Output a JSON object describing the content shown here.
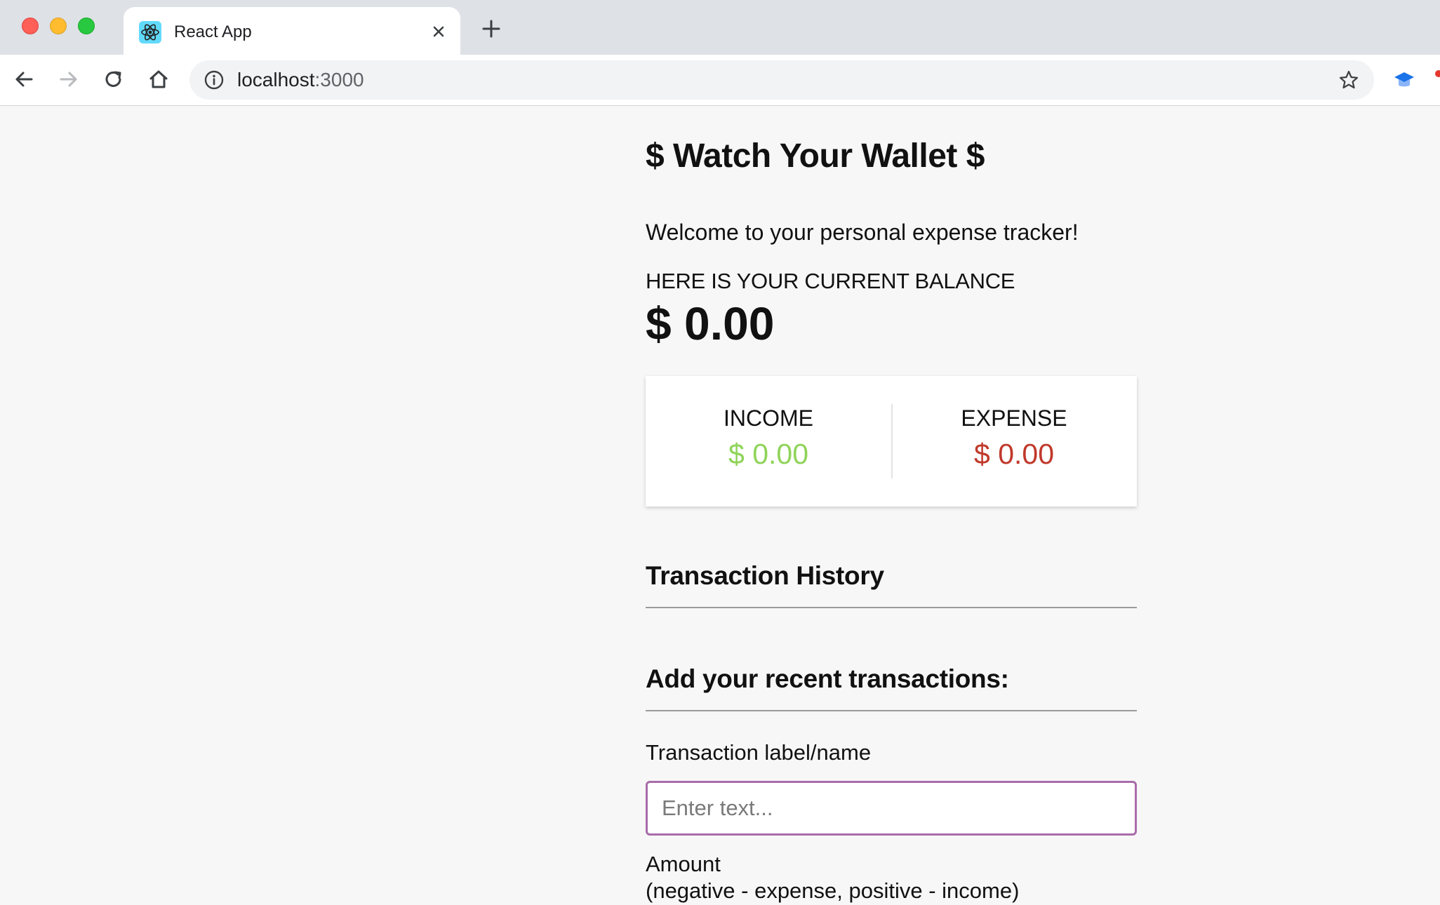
{
  "browser": {
    "tab_title": "React App",
    "url_host": "localhost",
    "url_port": ":3000"
  },
  "app": {
    "title": "$ Watch Your Wallet $",
    "welcome": "Welcome to your personal expense tracker!",
    "balance_label": "HERE IS YOUR CURRENT BALANCE",
    "balance_value": "$ 0.00",
    "income": {
      "label": "INCOME",
      "value": "$ 0.00",
      "color": "#8fd45a"
    },
    "expense": {
      "label": "EXPENSE",
      "value": "$ 0.00",
      "color": "#c0392b"
    },
    "history_title": "Transaction History",
    "add_title": "Add your recent transactions:",
    "form": {
      "label_field": "Transaction label/name",
      "label_placeholder": "Enter text...",
      "amount_label": "Amount",
      "amount_hint": "(negative - expense, positive - income)"
    }
  }
}
